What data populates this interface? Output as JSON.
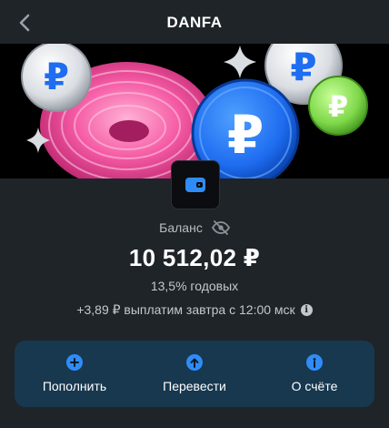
{
  "header": {
    "title": "DANFA",
    "back_icon": "chevron-left-icon"
  },
  "banner": {
    "currency_symbol": "₽",
    "icons": [
      "ruble-coin-icon",
      "sparkle-icon",
      "pink-knot-illustration"
    ]
  },
  "account": {
    "icon": "wallet-icon",
    "balance_label": "Баланс",
    "visibility_icon": "eye-crossed-icon",
    "balance": "10 512,02 ₽",
    "rate": "13,5% годовых",
    "payout": "+3,89 ₽ выплатим завтра с 12:00 мск",
    "payout_info_icon": "info-icon"
  },
  "actions": [
    {
      "label": "Пополнить",
      "icon": "plus-circle-icon"
    },
    {
      "label": "Перевести",
      "icon": "arrow-up-circle-icon"
    },
    {
      "label": "О счёте",
      "icon": "info-circle-icon"
    }
  ],
  "colors": {
    "background": "#1f2429",
    "accent_blue": "#2f8cf6",
    "actions_panel": "#17384f",
    "banner_background": "#000000",
    "coin_blue": "#1f6df0",
    "coin_green": "#7fd84a",
    "coin_silver": "#d9dde2",
    "pink": "#f55aa4"
  }
}
